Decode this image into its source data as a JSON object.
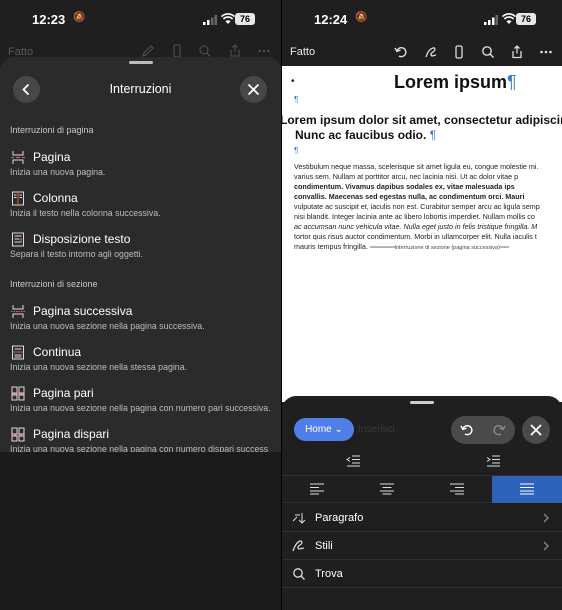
{
  "left": {
    "status": {
      "time": "12:23",
      "battery": "76"
    },
    "toolbar": {
      "done": "Fatto"
    },
    "sheet": {
      "title": "Interruzioni",
      "section_page": "Interruzioni di pagina",
      "section_section": "Interruzioni di sezione",
      "page_items": [
        {
          "title": "Pagina",
          "desc": "Inizia una nuova pagina.",
          "icon": "page-break-icon"
        },
        {
          "title": "Colonna",
          "desc": "Inizia il testo nella colonna successiva.",
          "icon": "column-break-icon"
        },
        {
          "title": "Disposizione testo",
          "desc": "Separa il testo intorno agli oggetti.",
          "icon": "text-wrapping-icon"
        }
      ],
      "section_items": [
        {
          "title": "Pagina successiva",
          "desc": "Inizia una nuova sezione nella pagina successiva.",
          "icon": "next-page-icon"
        },
        {
          "title": "Continua",
          "desc": "Inizia una nuova sezione nella stessa pagina.",
          "icon": "continuous-icon"
        },
        {
          "title": "Pagina pari",
          "desc": "Inizia una nuova sezione nella pagina con numero pari successiva.",
          "icon": "even-page-icon"
        },
        {
          "title": "Pagina dispari",
          "desc": "Inizia una nuova sezione nella pagina con numero dispari success",
          "icon": "odd-page-icon"
        }
      ]
    }
  },
  "right": {
    "status": {
      "time": "12:24",
      "battery": "76"
    },
    "toolbar": {
      "done": "Fatto"
    },
    "doc": {
      "title": "Lorem ipsum",
      "pilcrow": "¶",
      "bullet": "•",
      "heading_line1": "Lorem ipsum dolor sit amet, consectetur adipiscing",
      "heading_line2": "Nunc ac faucibus odio.",
      "body_lines": [
        "Vestibulum neque massa, scelerisque sit amet ligula eu, congue molestie mi.",
        "varius sem. Nullam at porttitor arcu, nec lacinia nisi. Ut ac dolor vitae p",
        "condimentum. Vivamus dapibus sodales ex, vitae malesuada ips",
        "convallis. Maecenas sed egestas nulla, ac condimentum orci. Mauri",
        "vulputate ac suscipit et, iaculis non est. Curabitur semper arcu ac ligula semp",
        "nisi blandit. Integer lacinia ante ac libero lobortis imperdiet. Nullam mollis co",
        "ac accumsan nunc vehicula vitae. Nulla eget justo in felis tristique fringilla. M",
        "tortor quis risus auctor condimentum. Morbi in ullamcorper elit. Nulla iaculis t",
        "mauris tempus fringilla."
      ],
      "section_break": "Interruzione di sezione (pagina successiva)"
    },
    "ribbon": {
      "tab": "Home",
      "ghost": "Inserisci",
      "menu": [
        {
          "label": "Paragrafo",
          "icon": "paragraph-icon"
        },
        {
          "label": "Stili",
          "icon": "styles-icon"
        },
        {
          "label": "Trova",
          "icon": "search-icon"
        }
      ]
    }
  }
}
